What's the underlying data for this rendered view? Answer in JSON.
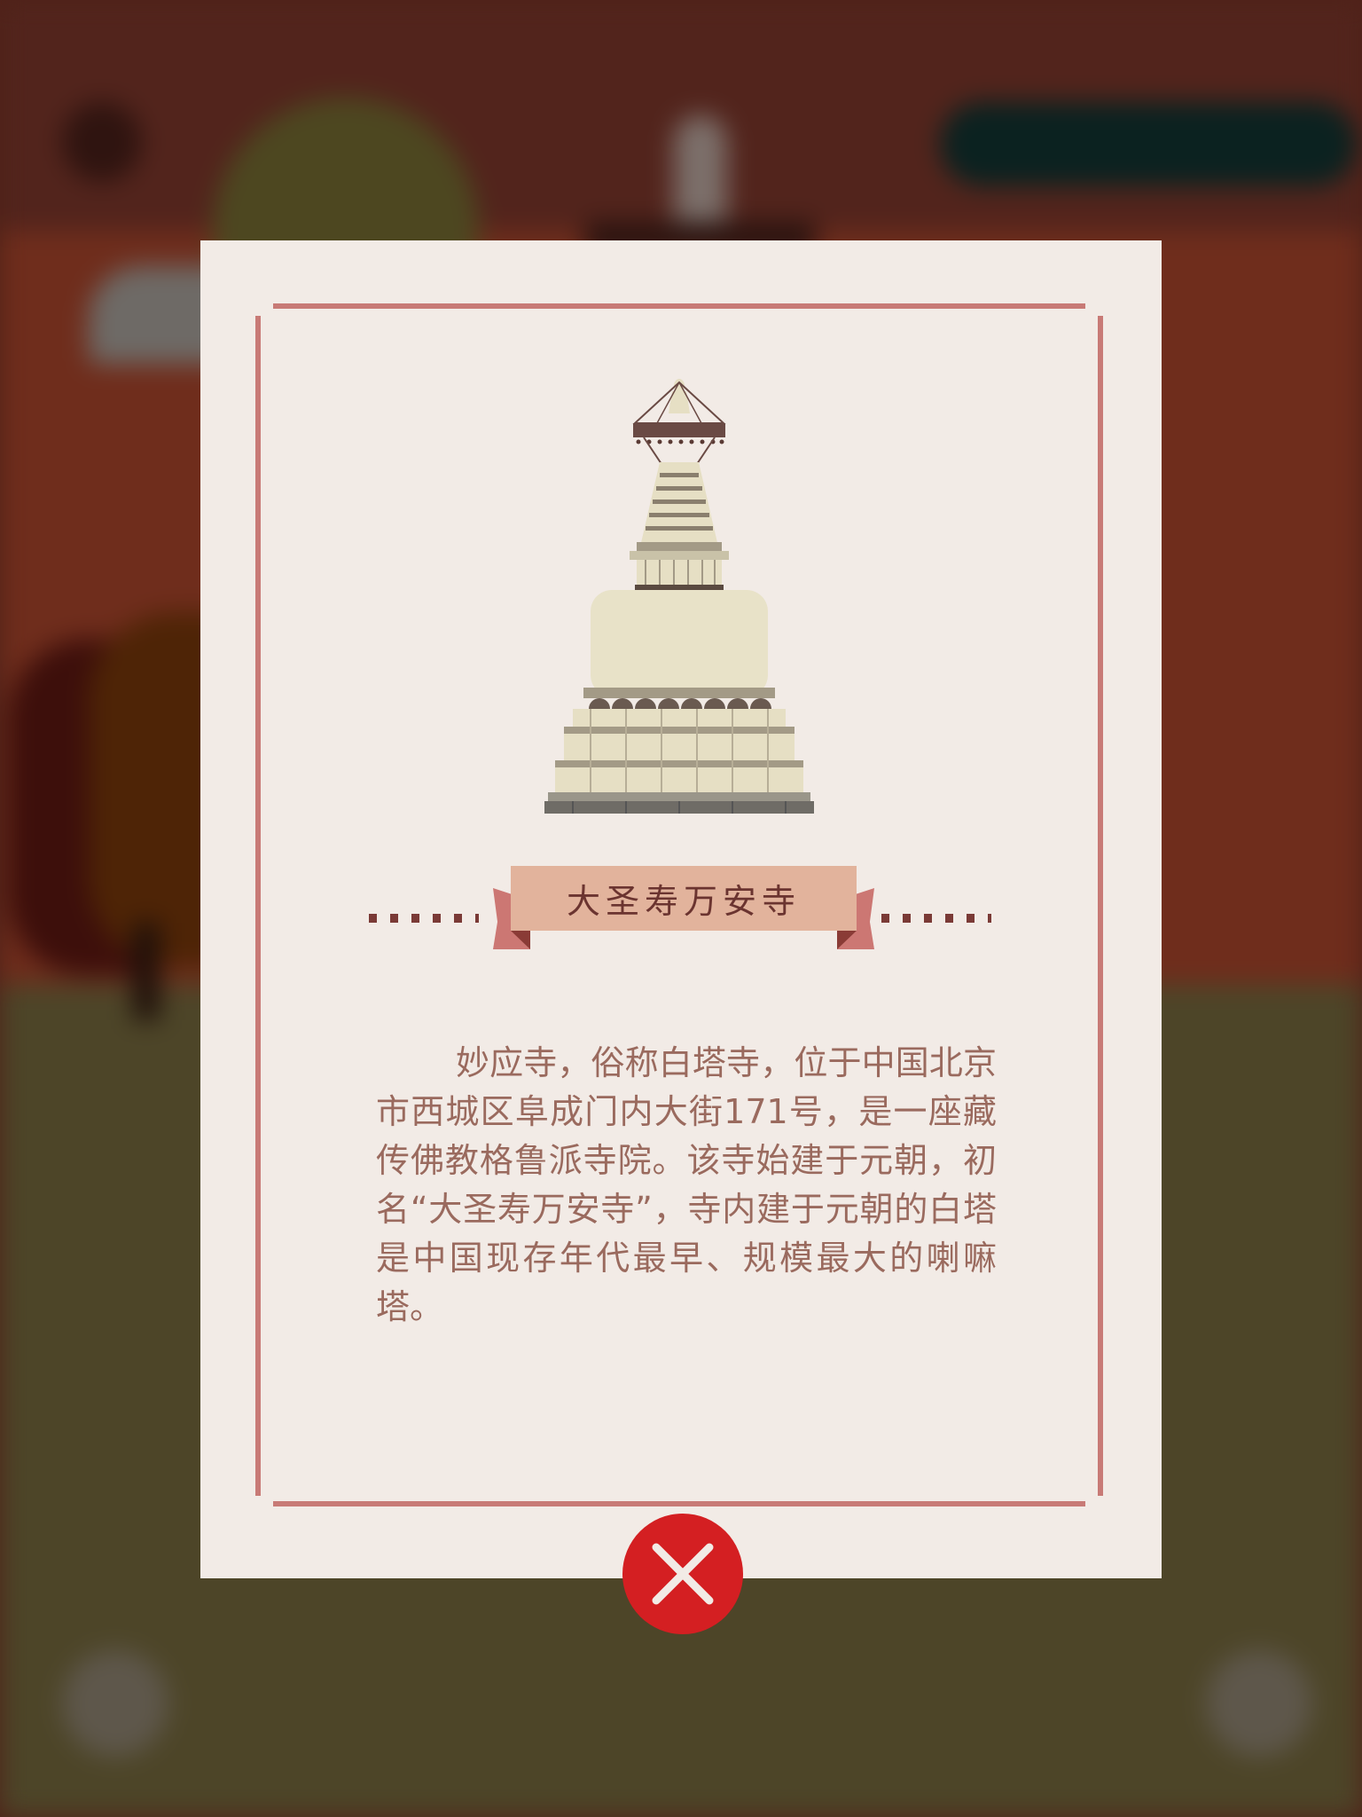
{
  "modal": {
    "title": "大圣寿万安寺",
    "description": "妙应寺，俗称白塔寺，位于中国北京市西城区阜成门内大街171号，是一座藏传佛教格鲁派寺院。该寺始建于元朝，初名“大圣寿万安寺”，寺内建于元朝的白塔是中国现存年代最早、规模最大的喇嘛塔。",
    "illustration_icon": "white-pagoda-icon",
    "close_icon": "close-icon"
  },
  "colors": {
    "card_background": "#f2ebe6",
    "frame": "#c87a76",
    "ribbon": "#e2b39c",
    "title_text": "#6b3430",
    "body_text": "#9a6a5e",
    "close_button": "#d41f22"
  }
}
